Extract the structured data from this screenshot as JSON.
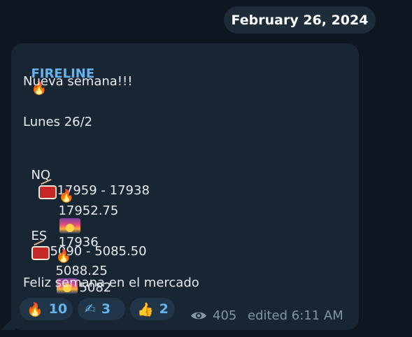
{
  "date_label": "February 26, 2024",
  "message": {
    "sender": "FIRELINE",
    "sender_emoji": "🔥",
    "lines": [
      "Nueva semana!!!",
      "Lunes 26/2",
      "NQ",
      "17959 - 17938",
      "17952.75",
      "17936",
      "ES",
      "5090 - 5085.50",
      "5088.25",
      "5082",
      "Feliz semana en el mercado"
    ],
    "fire_emoji": "🔥",
    "drum_icon": "drum-icon",
    "sunrise_icon": "sunrise-icon"
  },
  "reactions": [
    {
      "emoji": "🔥",
      "count": "10"
    },
    {
      "emoji": "✍",
      "count": "3"
    },
    {
      "emoji": "👍",
      "count": "2"
    }
  ],
  "views": "405",
  "edited": "edited 6:11 AM",
  "colors": {
    "background": "#0e1621",
    "bubble": "#182533",
    "sender": "#64b5ef",
    "reaction_bg": "#213548",
    "meta": "#8394a3"
  }
}
